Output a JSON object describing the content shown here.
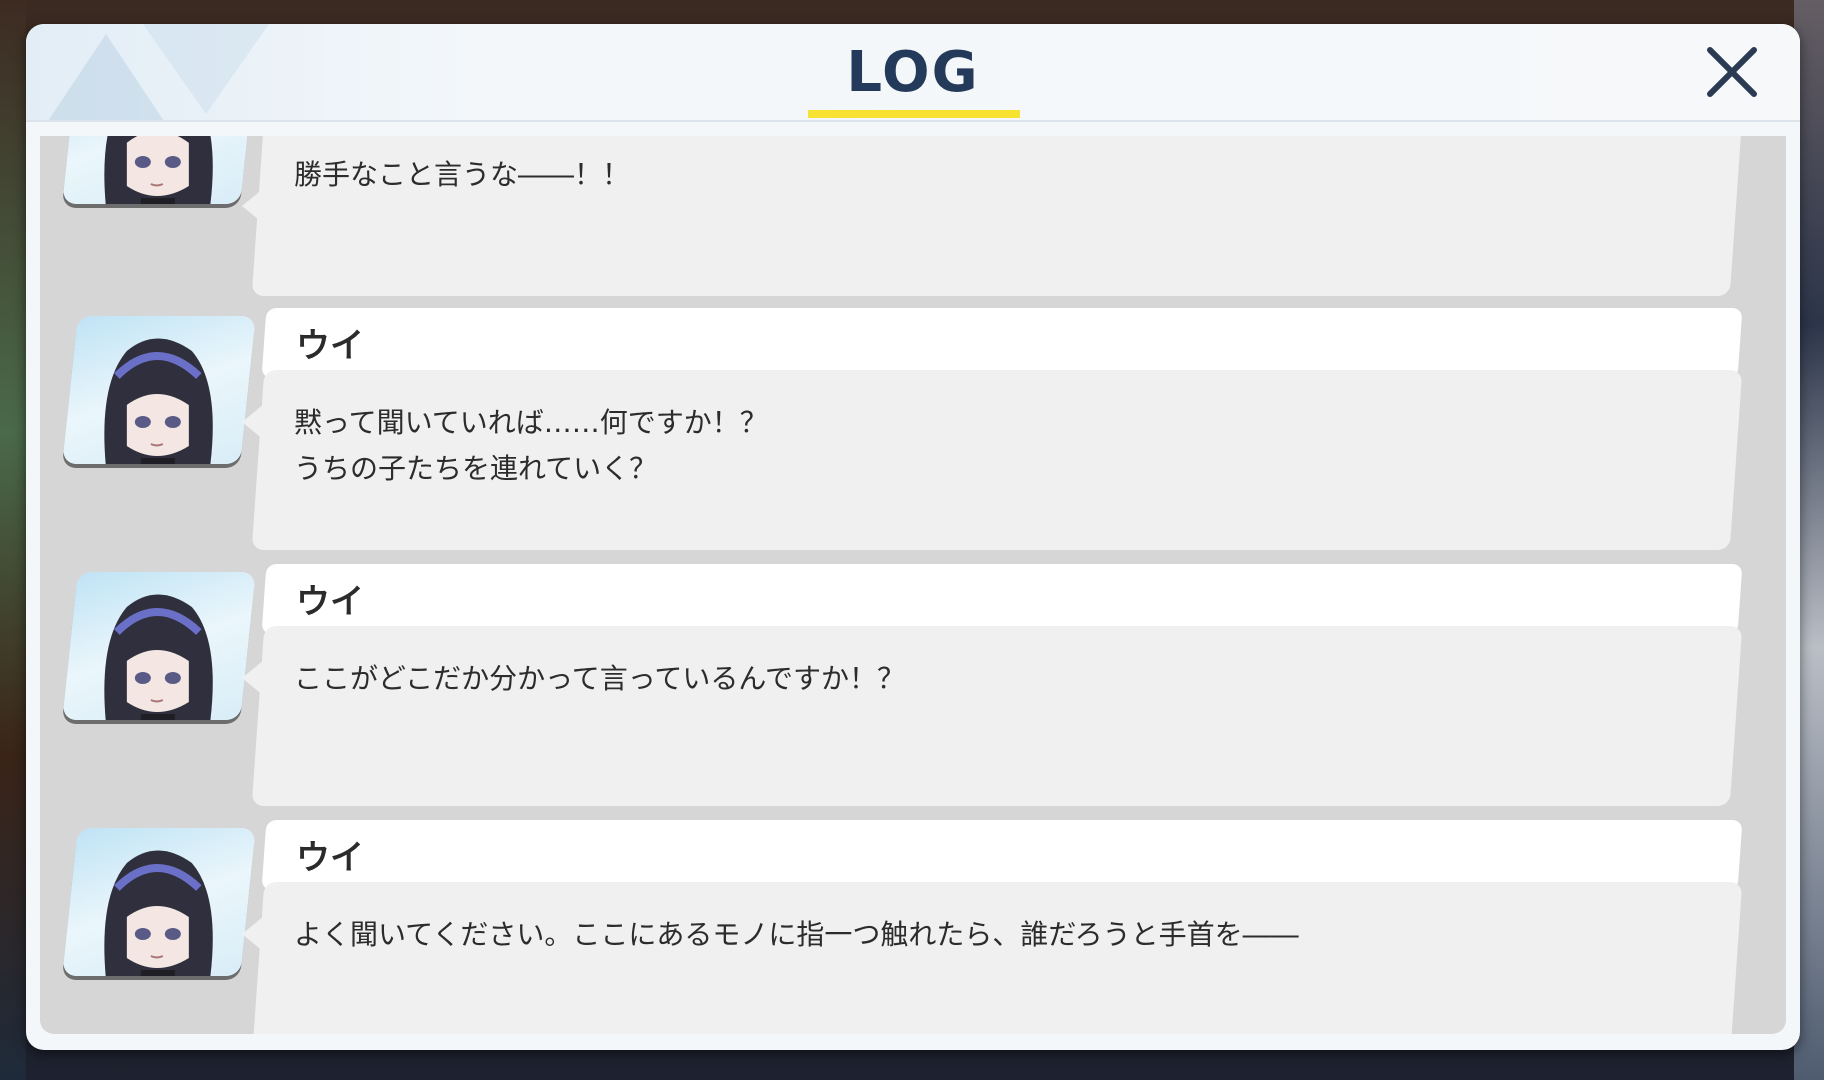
{
  "window": {
    "title": "LOG",
    "accent_color": "#f8e231",
    "title_color": "#243a5a"
  },
  "icons": {
    "close": "close-icon",
    "portrait": "character-portrait-icon"
  },
  "entries": [
    {
      "speaker": "",
      "text": "勝手なこと言うな――！！"
    },
    {
      "speaker": "ウイ",
      "text": "黙って聞いていれば……何ですか！？\nうちの子たちを連れていく？"
    },
    {
      "speaker": "ウイ",
      "text": "ここがどこだか分かって言っているんですか！？"
    },
    {
      "speaker": "ウイ",
      "text": "よく聞いてください。ここにあるモノに指一つ触れたら、誰だろうと手首を――"
    }
  ]
}
